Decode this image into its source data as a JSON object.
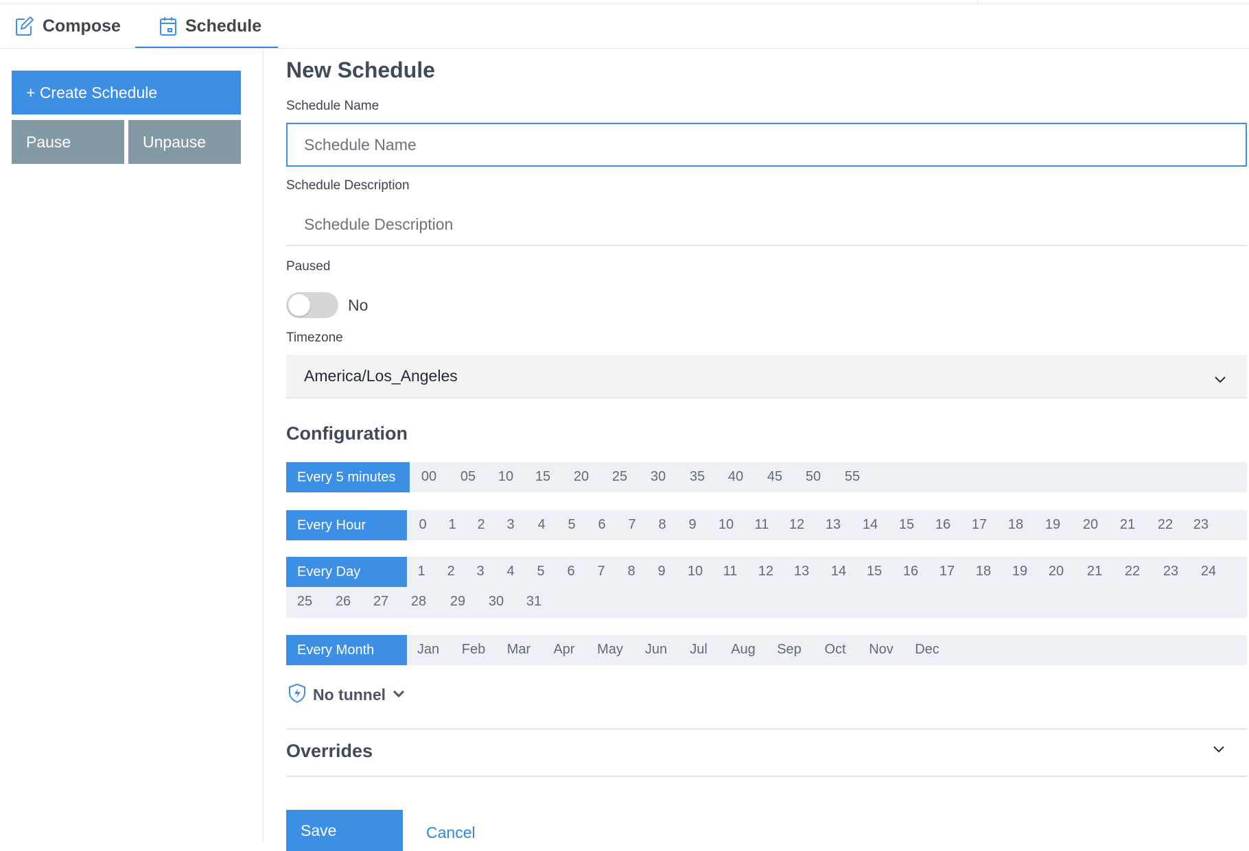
{
  "tabs": {
    "compose": "Compose",
    "schedule": "Schedule",
    "active": "Schedule"
  },
  "sidebar": {
    "create": "+ Create Schedule",
    "pause": "Pause",
    "unpause": "Unpause"
  },
  "form": {
    "title": "New Schedule",
    "name_label": "Schedule Name",
    "name_placeholder": "Schedule Name",
    "name_value": "",
    "desc_label": "Schedule Description",
    "desc_placeholder": "Schedule Description",
    "desc_value": "",
    "paused_label": "Paused",
    "paused_state": "No",
    "tz_label": "Timezone",
    "tz_value": "America/Los_Angeles"
  },
  "configuration": {
    "title": "Configuration",
    "minutes": {
      "label": "Every 5 minutes",
      "options": [
        "00",
        "05",
        "10",
        "15",
        "20",
        "25",
        "30",
        "35",
        "40",
        "45",
        "50",
        "55"
      ]
    },
    "hours": {
      "label": "Every Hour",
      "options": [
        "0",
        "1",
        "2",
        "3",
        "4",
        "5",
        "6",
        "7",
        "8",
        "9",
        "10",
        "11",
        "12",
        "13",
        "14",
        "15",
        "16",
        "17",
        "18",
        "19",
        "20",
        "21",
        "22",
        "23"
      ]
    },
    "days": {
      "label": "Every Day",
      "options": [
        "1",
        "2",
        "3",
        "4",
        "5",
        "6",
        "7",
        "8",
        "9",
        "10",
        "11",
        "12",
        "13",
        "14",
        "15",
        "16",
        "17",
        "18",
        "19",
        "20",
        "21",
        "22",
        "23",
        "24",
        "25",
        "26",
        "27",
        "28",
        "29",
        "30",
        "31"
      ]
    },
    "months": {
      "label": "Every Month",
      "options": [
        "Jan",
        "Feb",
        "Mar",
        "Apr",
        "May",
        "Jun",
        "Jul",
        "Aug",
        "Sep",
        "Oct",
        "Nov",
        "Dec"
      ]
    }
  },
  "tunnel": {
    "label": "No tunnel"
  },
  "overrides": {
    "title": "Overrides"
  },
  "actions": {
    "save": "Save",
    "cancel": "Cancel"
  },
  "colors": {
    "accent": "#3d8fe6",
    "secondary_button": "#839aa5",
    "option_row_bg": "#edf1f5"
  }
}
